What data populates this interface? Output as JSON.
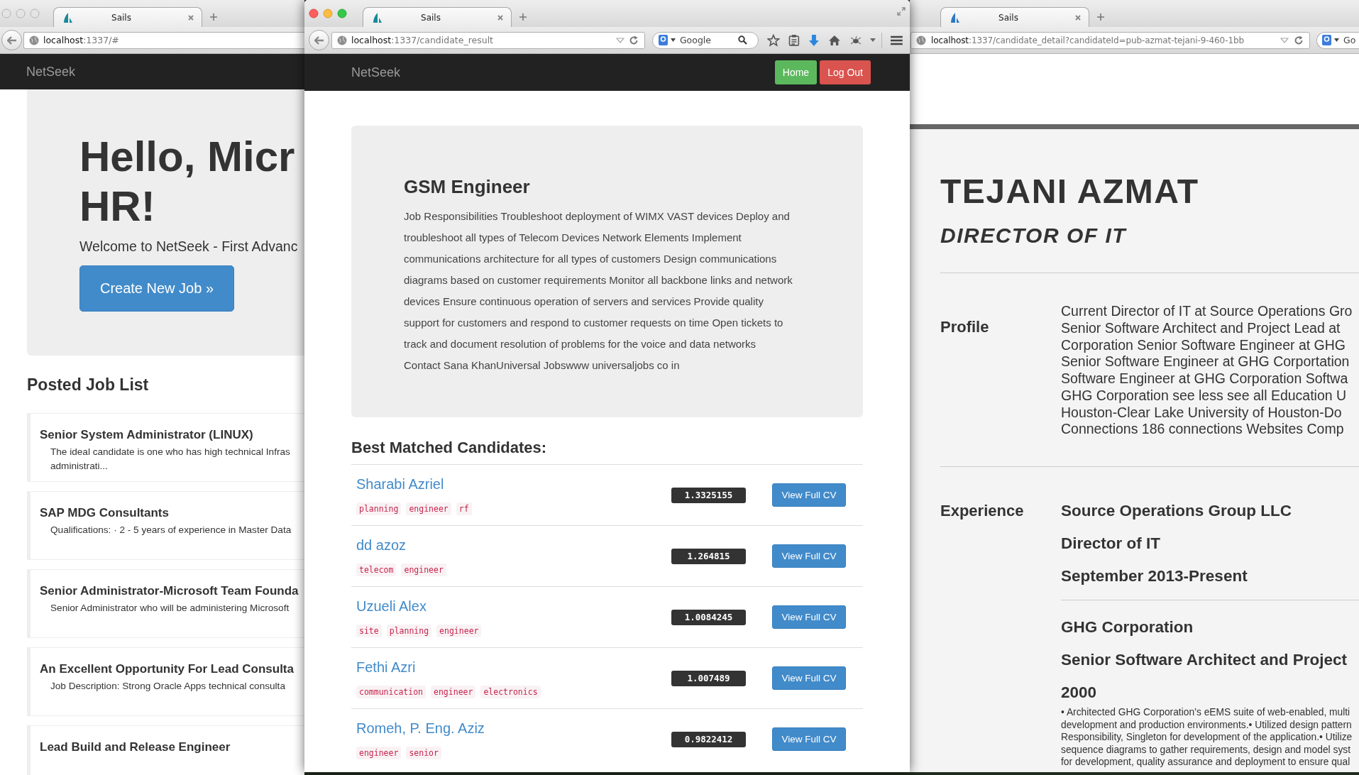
{
  "home_window": {
    "active": false,
    "tab": {
      "title": "Sails"
    },
    "url": {
      "host": "localhost",
      "path": ":1337/#"
    },
    "brand": "NetSeek",
    "hero": {
      "heading": [
        "Hello, Micr",
        "HR!"
      ],
      "text": "Welcome to NetSeek - First Advanc",
      "button": "Create New Job »"
    },
    "job_list": {
      "title": "Posted Job List",
      "jobs": [
        {
          "title": "Senior System Administrator (LINUX)",
          "description": [
            "The ideal candidate is one who has high technical Infras",
            "administrati..."
          ]
        },
        {
          "title": "SAP MDG Consultants",
          "description": [
            "Qualifications:  · 2 - 5 years of experience in Master Data"
          ]
        },
        {
          "title": "Senior Administrator-Microsoft Team Founda",
          "description": [
            "Senior Administrator who will be administering Microsoft"
          ]
        },
        {
          "title": "An Excellent Opportunity For Lead Consulta",
          "description": [
            "Job Description: Strong Oracle Apps technical consulta"
          ]
        },
        {
          "title": "Lead Build and Release Engineer"
        }
      ]
    }
  },
  "results_window": {
    "active": true,
    "tab": {
      "title": "Sails"
    },
    "url": {
      "host": "localhost",
      "path": ":1337/candidate_result"
    },
    "search": {
      "placeholder": "Google"
    },
    "brand": "NetSeek",
    "nav_buttons": [
      {
        "label": "Home",
        "kind": "success"
      },
      {
        "label": "Log Out",
        "kind": "danger"
      }
    ],
    "job": {
      "title": "GSM Engineer",
      "description": "Job Responsibilities Troubleshoot deployment of WIMX VAST devices Deploy and troubleshoot all types of Telecom Devices Network Elements Implement communications architecture for all types of customers Design communications diagrams based on customer requirements Monitor all backbone links and network devices Ensure continuous operation of servers and services Provide quality support for customers and respond to customer requests on time Open tickets to track and document resolution of problems for the voice and data networks Contact Sana KhanUniversal Jobswww universaljobs co in"
    },
    "candidates_title": "Best Matched Candidates:",
    "candidates": [
      {
        "name": "Sharabi Azriel",
        "tags": [
          "planning",
          "engineer",
          "rf"
        ],
        "score": "1.3325155",
        "button": "View Full CV"
      },
      {
        "name": "dd azoz",
        "tags": [
          "telecom",
          "engineer"
        ],
        "score": "1.264815",
        "button": "View Full CV"
      },
      {
        "name": "Uzueli Alex",
        "tags": [
          "site",
          "planning",
          "engineer"
        ],
        "score": "1.0084245",
        "button": "View Full CV"
      },
      {
        "name": "Fethi Azri",
        "tags": [
          "communication",
          "engineer",
          "electronics"
        ],
        "score": "1.007489",
        "button": "View Full CV"
      },
      {
        "name": "Romeh, P. Eng. Aziz",
        "tags": [
          "engineer",
          "senior"
        ],
        "score": "0.9822412",
        "button": "View Full CV"
      }
    ]
  },
  "detail_window": {
    "tab": {
      "title": "Sails"
    },
    "url": {
      "host": "localhost",
      "path": ":1337/candidate_detail?candidateId=pub-azmat-tejani-9-460-1bb"
    },
    "search": {
      "placeholder": "Go"
    },
    "name": "TEJANI AZMAT",
    "headline": "DIRECTOR OF IT",
    "profile": {
      "label": "Profile",
      "lines": [
        "Current Director of IT at Source Operations Gro",
        "Senior Software Architect and Project Lead at",
        "Corporation Senior Software Engineer at GHG",
        "Senior Software Engineer at GHG Corportation",
        "Software Engineer at GHG Corporation Softwa",
        "GHG Corporation see less see all Education U",
        "Houston-Clear Lake University of Houston-Do",
        "Connections 186 connections Websites Comp"
      ]
    },
    "experience": {
      "label": "Experience",
      "entries": [
        {
          "company": "Source Operations Group LLC",
          "role": "Director of IT",
          "dates": "September 2013-Present"
        },
        {
          "company": "GHG Corporation",
          "role": "Senior Software Architect and Project",
          "dates": "2000",
          "description": [
            "• Architected GHG Corporation’s eEMS suite of web-enabled, multi",
            "development and production environments.• Utilized design pattern",
            "Responsibility, Singleton for development of the application.• Utilize",
            "sequence diagrams to gather requirements, design and model syst",
            "for development, quality assurance and deployment to ensure qual"
          ]
        }
      ]
    }
  }
}
